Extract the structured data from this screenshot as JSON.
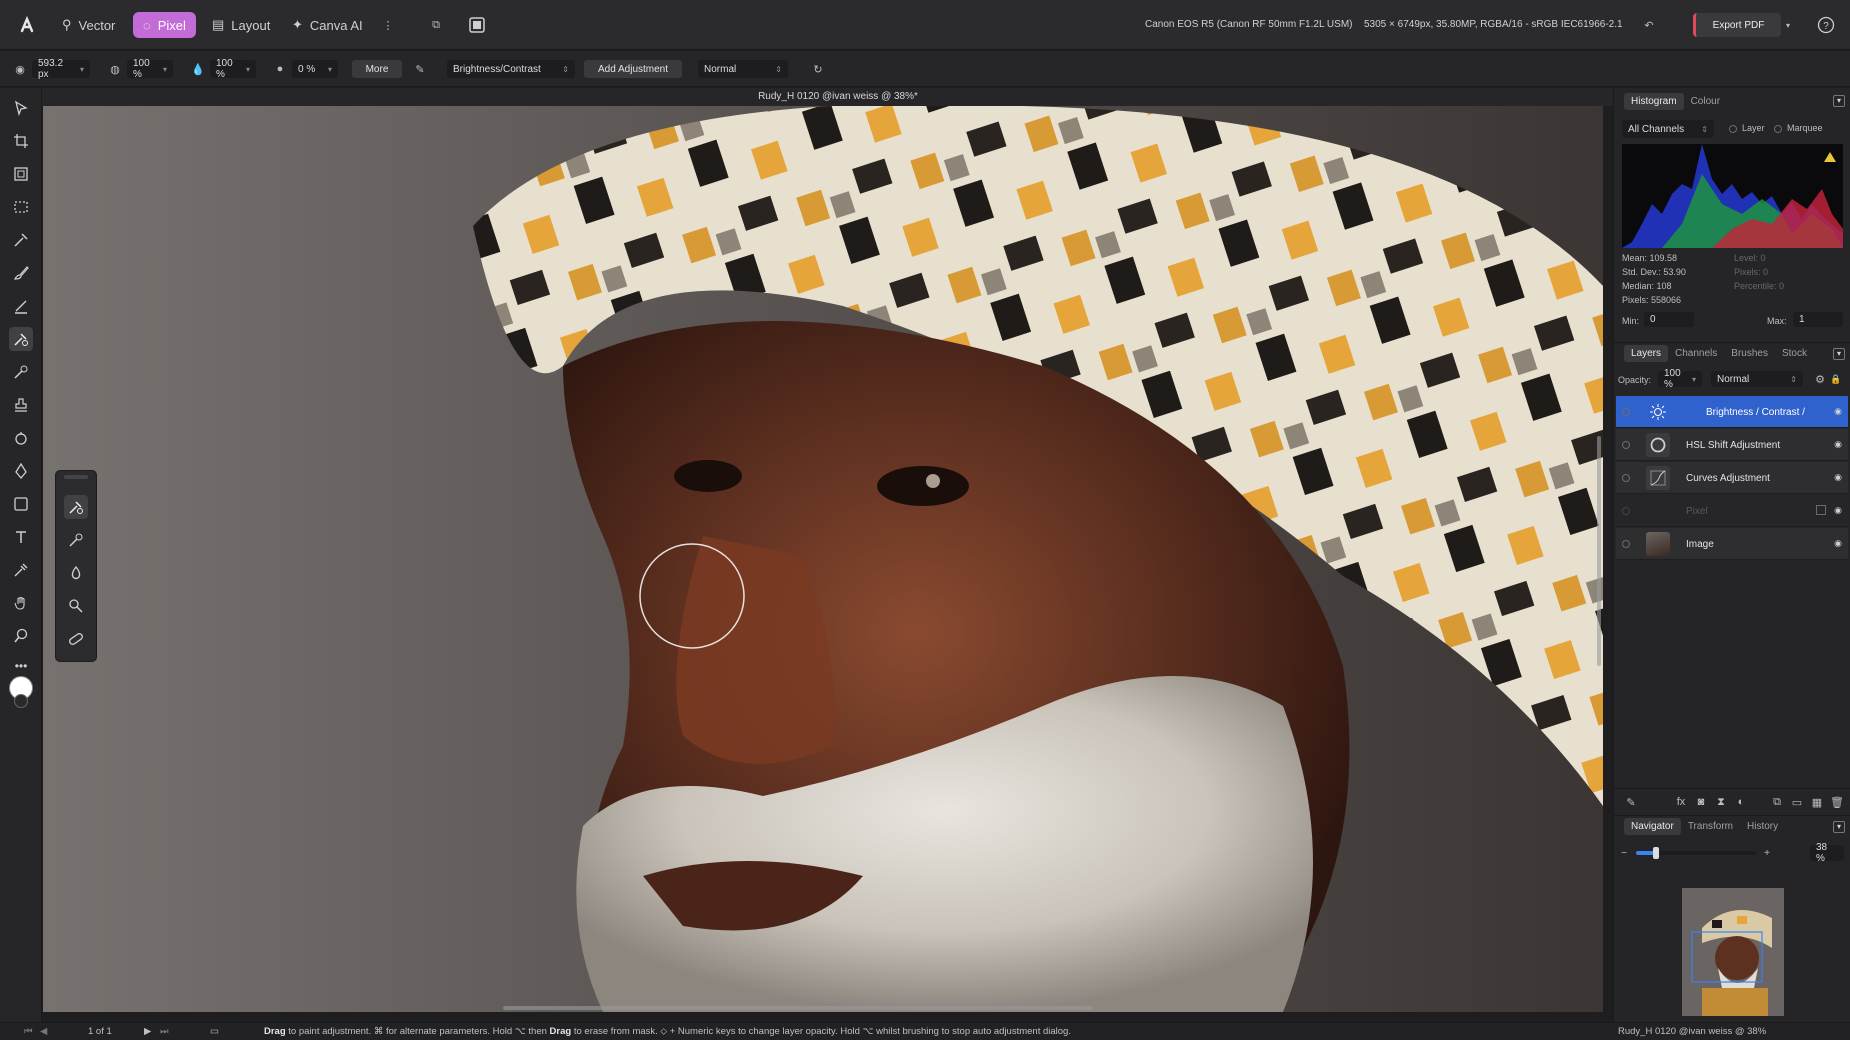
{
  "personas": {
    "vector": "Vector",
    "pixel": "Pixel",
    "layout": "Layout",
    "canva_ai": "Canva AI"
  },
  "camera_info": "Canon EOS R5 (Canon RF 50mm F1.2L USM)",
  "image_info": "5305 × 6749px, 35.80MP, RGBA/16 - sRGB IEC61966-2.1",
  "export_label": "Export PDF",
  "context_bar": {
    "width": "593.2 px",
    "opacity": "100 %",
    "flow": "100 %",
    "hardness": "0 %",
    "more": "More",
    "adjustment_select": "Brightness/Contrast",
    "add_adjustment": "Add Adjustment",
    "blend_mode": "Normal"
  },
  "document_title": "Rudy_H 0120 @ivan weiss @ 38%*",
  "histogram_panel": {
    "tabs": [
      "Histogram",
      "Colour"
    ],
    "channels": "All Channels",
    "layer_label": "Layer",
    "marquee_label": "Marquee",
    "stats_left": [
      "Mean: 109.58",
      "Std. Dev.: 53.90",
      "Median: 108",
      "Pixels: 558066"
    ],
    "stats_right": [
      "Level: 0",
      "Pixels: 0",
      "Percentile: 0"
    ],
    "min_label": "Min:",
    "min_value": "0",
    "max_label": "Max:",
    "max_value": "1"
  },
  "layers_panel": {
    "tabs": [
      "Layers",
      "Channels",
      "Brushes",
      "Stock"
    ],
    "opacity_label": "Opacity:",
    "opacity_value": "100 %",
    "blend_mode": "Normal",
    "layers": [
      {
        "name": "Brightness / Contrast /",
        "icon": "sun-icon"
      },
      {
        "name": "HSL Shift Adjustment",
        "icon": "hsl-wheel-icon"
      },
      {
        "name": "Curves Adjustment",
        "icon": "curves-icon"
      },
      {
        "name": "Pixel",
        "icon": "pixel-layer-icon"
      },
      {
        "name": "Image",
        "icon": "image-thumbnail"
      }
    ]
  },
  "navigator_panel": {
    "tabs": [
      "Navigator",
      "Transform",
      "History"
    ],
    "zoom": "38 %"
  },
  "status": {
    "page": "1 of 1",
    "doc_name": "Rudy_H 0120 @ivan weiss @ 38%"
  }
}
